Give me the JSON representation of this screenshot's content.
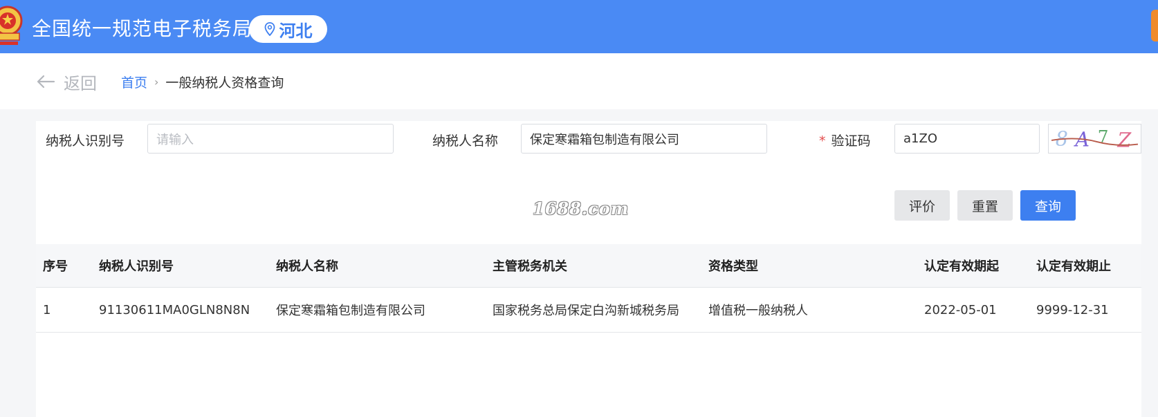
{
  "header": {
    "title": "全国统一规范电子税务局",
    "region": "河北",
    "brand_color": "#4a8af4"
  },
  "icons": {
    "emblem": "tax-emblem-icon",
    "location": "location-pin-icon",
    "back": "arrow-left-icon",
    "crumb_separator": "chevron-right-icon"
  },
  "nav": {
    "back_label": "返回",
    "breadcrumb_home": "首页",
    "breadcrumb_separator": "›",
    "breadcrumb_current": "一般纳税人资格查询"
  },
  "form": {
    "taxpayer_id_label": "纳税人识别号",
    "taxpayer_id_value": "",
    "taxpayer_id_placeholder": "请输入",
    "taxpayer_name_label": "纳税人名称",
    "taxpayer_name_value": "保定寒霜箱包制造有限公司",
    "captcha_required_mark": "*",
    "captcha_label": "验证码",
    "captcha_value": "a1ZO",
    "captcha_image_text": "8A7Z"
  },
  "watermark": "1688.com",
  "buttons": {
    "evaluate": "评价",
    "reset": "重置",
    "query": "查询"
  },
  "table": {
    "columns": [
      "序号",
      "纳税人识别号",
      "纳税人名称",
      "主管税务机关",
      "资格类型",
      "认定有效期起",
      "认定有效期止"
    ],
    "rows": [
      [
        "1",
        "91130611MA0GLN8N8N",
        "保定寒霜箱包制造有限公司",
        "国家税务总局保定白沟新城税务局",
        "增值税一般纳税人",
        "2022-05-01",
        "9999-12-31"
      ]
    ]
  },
  "colors": {
    "accent": "#3d7ff0",
    "required": "#e34d4d"
  }
}
